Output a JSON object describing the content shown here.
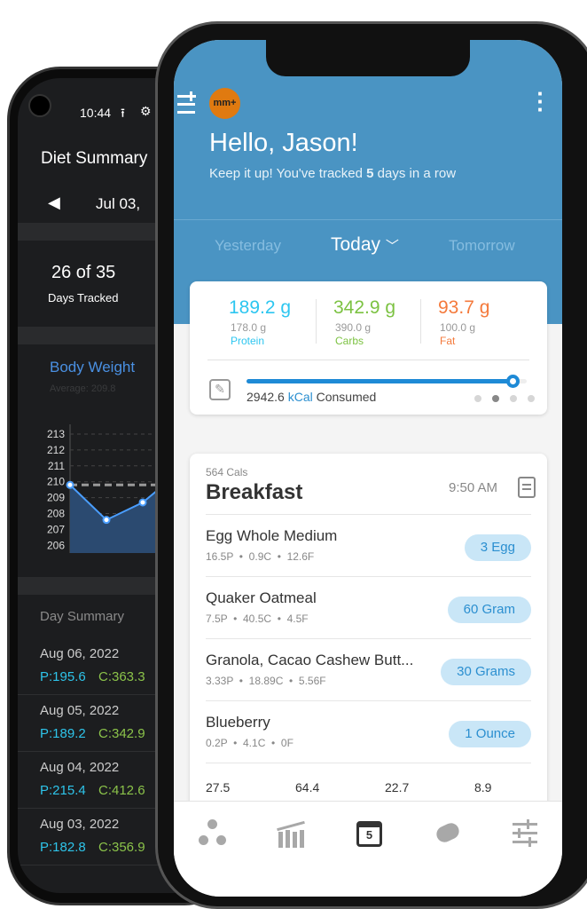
{
  "back_phone": {
    "status_time": "10:44",
    "title": "Diet Summary",
    "date_range": "Jul 03,",
    "days_tracked": "26 of 35",
    "days_tracked_label": "Days Tracked",
    "body_weight_title": "Body Weight",
    "body_weight_average": "Average: 209.8",
    "day_summary_title": "Day Summary",
    "days": [
      {
        "date": "Aug 06, 2022",
        "protein": "P:195.6",
        "carbs": "C:363.3"
      },
      {
        "date": "Aug 05, 2022",
        "protein": "P:189.2",
        "carbs": "C:342.9"
      },
      {
        "date": "Aug 04, 2022",
        "protein": "P:215.4",
        "carbs": "C:412.6"
      },
      {
        "date": "Aug 03, 2022",
        "protein": "P:182.8",
        "carbs": "C:356.9"
      }
    ]
  },
  "chart_data": {
    "type": "area",
    "title": "Body Weight",
    "yticks": [
      "213",
      "212",
      "211",
      "210",
      "209",
      "208",
      "207",
      "206"
    ],
    "ylim": [
      205.5,
      213.5
    ],
    "values": [
      209.8,
      207.6,
      208.7
    ],
    "average": 209.8,
    "grid": true
  },
  "front_phone": {
    "logo_text": "mm+",
    "greeting": "Hello, Jason!",
    "streak_prefix": "Keep it up! You've tracked ",
    "streak_count": "5",
    "streak_suffix": " days in a row",
    "day_nav": {
      "prev": "Yesterday",
      "current": "Today",
      "next": "Tomorrow"
    },
    "macros": [
      {
        "value": "189.2 g",
        "target": "178.0 g",
        "label": "Protein",
        "color": "#2dc6f0"
      },
      {
        "value": "342.9 g",
        "target": "390.0 g",
        "label": "Carbs",
        "color": "#7cc242"
      },
      {
        "value": "93.7 g",
        "target": "100.0 g",
        "label": "Fat",
        "color": "#f47a3c"
      }
    ],
    "calories": {
      "value": "2942.6",
      "unit": "kCal",
      "suffix": " Consumed",
      "progress": 0.95
    },
    "page_dots": {
      "count": 4,
      "active": 1
    },
    "meal": {
      "cals": "564 Cals",
      "name": "Breakfast",
      "time": "9:50 AM",
      "items": [
        {
          "name": "Egg Whole Medium",
          "macros": "16.5P  •  0.9C  •  12.6F",
          "serving": "3 Egg"
        },
        {
          "name": "Quaker Oatmeal",
          "macros": "7.5P  •  40.5C  •  4.5F",
          "serving": "60 Gram"
        },
        {
          "name": "Granola, Cacao Cashew Butt...",
          "macros": "3.33P  •  18.89C  •  5.56F",
          "serving": "30 Grams"
        },
        {
          "name": "Blueberry",
          "macros": "0.2P  •  4.1C  •  0F",
          "serving": "1 Ounce"
        }
      ],
      "totals": [
        "27.5",
        "64.4",
        "22.7",
        "8.9"
      ]
    },
    "tabs": [
      "community-icon",
      "progress-chart-icon",
      "calendar-today-icon",
      "coach-whistle-icon",
      "settings-sliders-icon"
    ],
    "calendar_day": "5"
  }
}
